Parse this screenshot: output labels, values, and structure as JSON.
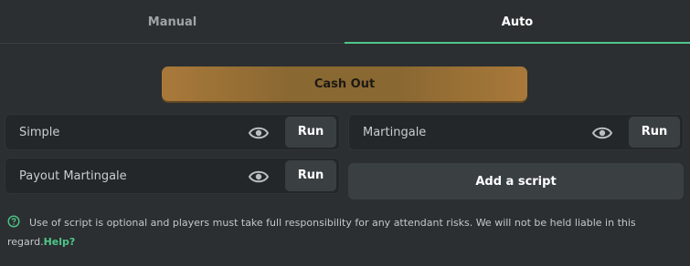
{
  "tabs": [
    {
      "label": "Manual",
      "active": false
    },
    {
      "label": "Auto",
      "active": true
    }
  ],
  "cashout": {
    "label": "Cash Out"
  },
  "scripts": [
    {
      "name": "Simple",
      "run_label": "Run",
      "icon": "eye-icon"
    },
    {
      "name": "Martingale",
      "run_label": "Run",
      "icon": "eye-icon"
    },
    {
      "name": "Payout Martingale",
      "run_label": "Run",
      "icon": "eye-icon"
    }
  ],
  "add_script": {
    "label": "Add a script"
  },
  "disclaimer": {
    "icon": "help-circle-icon",
    "text": "Use of script is optional and players must take full responsibility for any attendant risks. We will not be held liable in this regard.",
    "link": "Help?"
  },
  "colors": {
    "background": "#2b2f31",
    "accent": "#4fc58a",
    "cashout": "#8a6832",
    "button": "#3a3f42"
  }
}
